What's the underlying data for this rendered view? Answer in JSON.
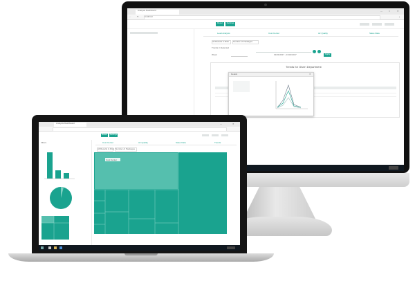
{
  "monitor": {
    "browser": {
      "tab_title": "Analysis Dashboard",
      "address": "localhost"
    },
    "toolbar": {
      "button_1": "Reset",
      "button_2": "Settings"
    },
    "tabs": [
      "Lead Analysis",
      "Cost Center",
      "Air Quality",
      "Sales Data"
    ],
    "filter": {
      "chip_1": "All Results in Risk",
      "chip_2": "Number of Packages",
      "label": "Trends in Selected",
      "value_label": "Week",
      "date_range": "01/01/2017 - 01/31/2017",
      "go_button": "Apply"
    },
    "panel": {
      "title": "Trends for Given Department"
    },
    "dialog": {
      "title": "Details"
    }
  },
  "laptop": {
    "browser": {
      "tab_title": "Analysis Dashboard"
    },
    "toolbar": {
      "button_1": "Reset",
      "button_2": "Settings"
    },
    "tabs": [
      "Cost Center",
      "Air Quality",
      "Sales Data",
      "Trends"
    ],
    "filter": {
      "chip_1": "All Results in Risk",
      "chip_2": "Number of Packages"
    },
    "sidebar": {
      "title": "Filters"
    },
    "treemap": {
      "label": "Cost Center"
    }
  },
  "colors": {
    "accent": "#1aa38f",
    "bezel": "#111111"
  }
}
